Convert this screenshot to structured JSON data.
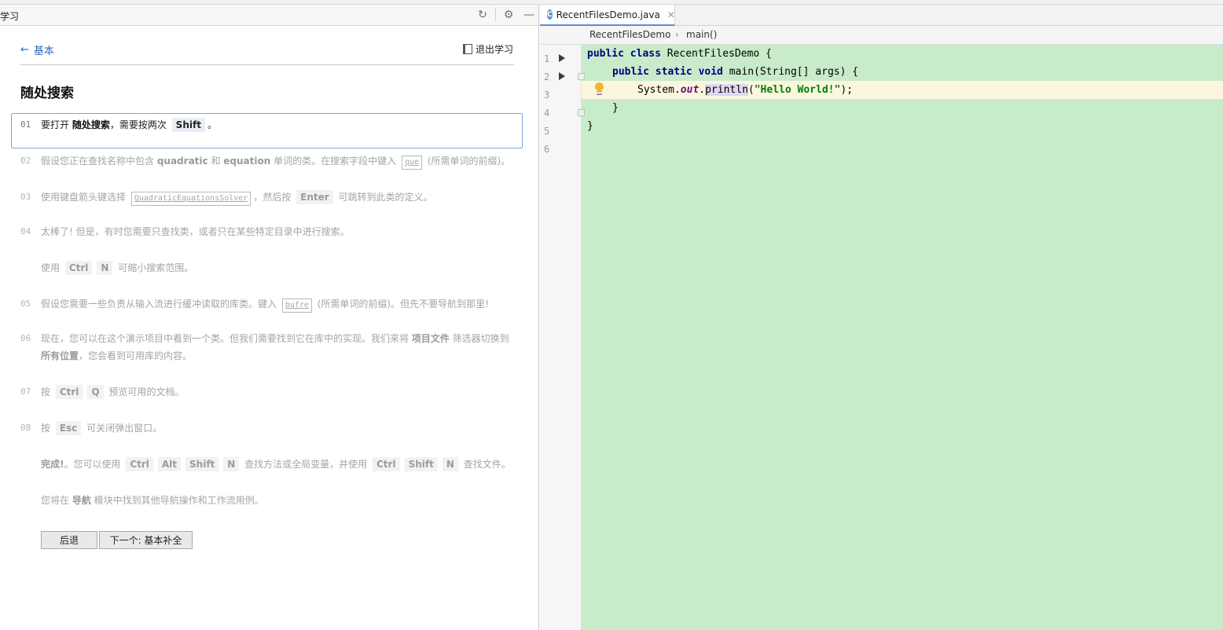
{
  "panel": {
    "title": "学习"
  },
  "header": {
    "back_label": "基本",
    "exit_label": "退出学习"
  },
  "page_title": "随处搜索",
  "steps": [
    {
      "num": "01",
      "parts": [
        "要打开 ",
        "随处搜索",
        "，需要按两次 ",
        "Shift",
        "。"
      ]
    },
    {
      "num": "02",
      "parts": [
        "假设您正在查找名称中包含 ",
        "quadratic",
        " 和 ",
        "equation",
        " 单词的类。在搜索字段中键入 ",
        "que",
        " (所需单词的前缀)。"
      ]
    },
    {
      "num": "03",
      "parts": [
        "使用键盘箭头键选择 ",
        "QuadraticEquationsSolver",
        "，然后按 ",
        "Enter",
        " 可跳转到此类的定义。"
      ]
    },
    {
      "num": "04",
      "parts": [
        "太棒了! 但是，有时您需要只查找类，或者只在某些特定目录中进行搜索。"
      ]
    },
    {
      "num": "",
      "parts": [
        "使用 ",
        "Ctrl",
        " ",
        "N",
        " 可缩小搜索范围。"
      ]
    },
    {
      "num": "05",
      "parts": [
        "假设您需要一些负责从输入流进行缓冲读取的库类。键入 ",
        "bufre",
        " (所需单词的前缀)。但先不要导航到那里!"
      ]
    },
    {
      "num": "06",
      "parts": [
        "现在，您可以在这个演示项目中看到一个类。但我们需要找到它在库中的实现。我们来将 ",
        "项目文件",
        " 筛选器切换到 ",
        "所有位置",
        "，您会看到可用库的内容。"
      ]
    },
    {
      "num": "07",
      "parts": [
        "按 ",
        "Ctrl",
        " ",
        "Q",
        " 预览可用的文档。"
      ]
    },
    {
      "num": "08",
      "parts": [
        "按 ",
        "Esc",
        " 可关闭弹出窗口。"
      ]
    },
    {
      "num": "",
      "parts": [
        "完成!",
        "。您可以使用 ",
        "Ctrl",
        " ",
        "Alt",
        " ",
        "Shift",
        " ",
        "N",
        " 查找方法或全局变量，并使用 ",
        "Ctrl",
        " ",
        "Shift",
        " ",
        "N",
        " 查找文件。"
      ]
    },
    {
      "num": "",
      "parts": [
        "您将在 ",
        "导航",
        " 模块中找到其他导航操作和工作流用例。"
      ]
    }
  ],
  "buttons": {
    "back": "后退",
    "next": "下一个: 基本补全"
  },
  "editor": {
    "tab_label": "RecentFilesDemo.java",
    "tab_icon": "C",
    "crumb_class": "RecentFilesDemo",
    "crumb_sep": "›",
    "crumb_method": "main()",
    "line_numbers": [
      "1",
      "2",
      "3",
      "4",
      "5",
      "6"
    ],
    "code": {
      "l1_kw": "public class",
      "l1_rest": " RecentFilesDemo {",
      "l2_kw": "public static void",
      "l2_rest": " main(String[] args) {",
      "l3_a": "System.",
      "l3_field": "out",
      "l3_dot": ".",
      "l3_method": "println",
      "l3_paren": "(",
      "l3_str": "\"Hello World!\"",
      "l3_end": ");",
      "l4": "}",
      "l5": "}"
    }
  },
  "colors": {
    "editor_bg": "#c8ecca",
    "link": "#2d6bbd",
    "active_border": "#7fa3d6"
  }
}
